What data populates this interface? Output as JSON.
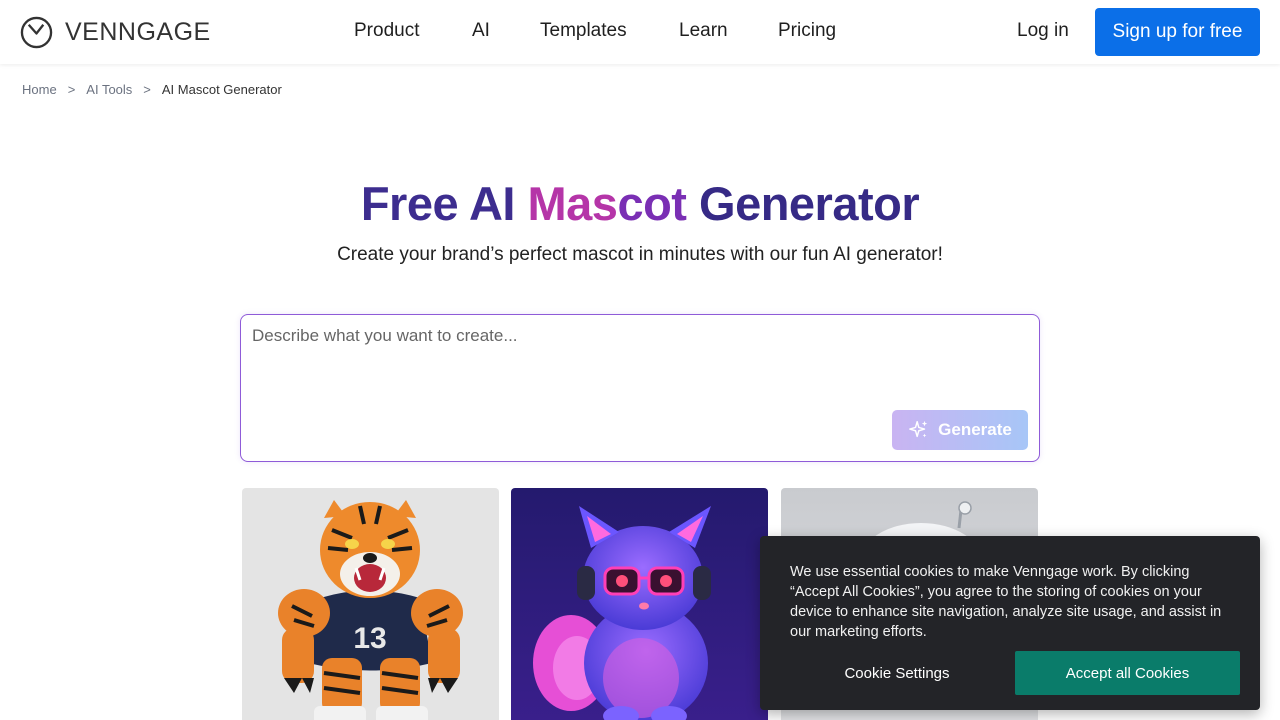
{
  "header": {
    "logo_text": "VENNGAGE",
    "nav": [
      {
        "label": "Product"
      },
      {
        "label": "AI"
      },
      {
        "label": "Templates"
      },
      {
        "label": "Learn"
      },
      {
        "label": "Pricing"
      }
    ],
    "login_label": "Log in",
    "signup_label": "Sign up for free",
    "signup_color": "#0b6fe8"
  },
  "breadcrumb": {
    "items": [
      "Home",
      "AI Tools",
      "AI Mascot Generator"
    ],
    "separator": ">"
  },
  "hero": {
    "title_word1": "Free",
    "title_word2": "AI",
    "title_word3_a": "Mas",
    "title_word3_b": "cot",
    "title_word4": "Generator",
    "subtitle": "Create your brand’s perfect mascot in minutes with our fun AI generator!"
  },
  "prompt": {
    "placeholder": "Describe what you want to create...",
    "value": "",
    "generate_label": "Generate",
    "generate_icon": "sparkles-icon"
  },
  "gallery": {
    "cards": [
      {
        "name": "tiger-mascot",
        "jersey_number": "13"
      },
      {
        "name": "neon-cat-mascot"
      },
      {
        "name": "robot-mascot"
      }
    ]
  },
  "cookie_banner": {
    "text": "We use essential cookies to make Venngage work. By clicking “Accept All Cookies”, you agree to the storing of cookies on your device to enhance site navigation, analyze site usage, and assist in our marketing efforts.",
    "settings_label": "Cookie Settings",
    "accept_label": "Accept all Cookies",
    "accept_color": "#0a7c6a"
  }
}
